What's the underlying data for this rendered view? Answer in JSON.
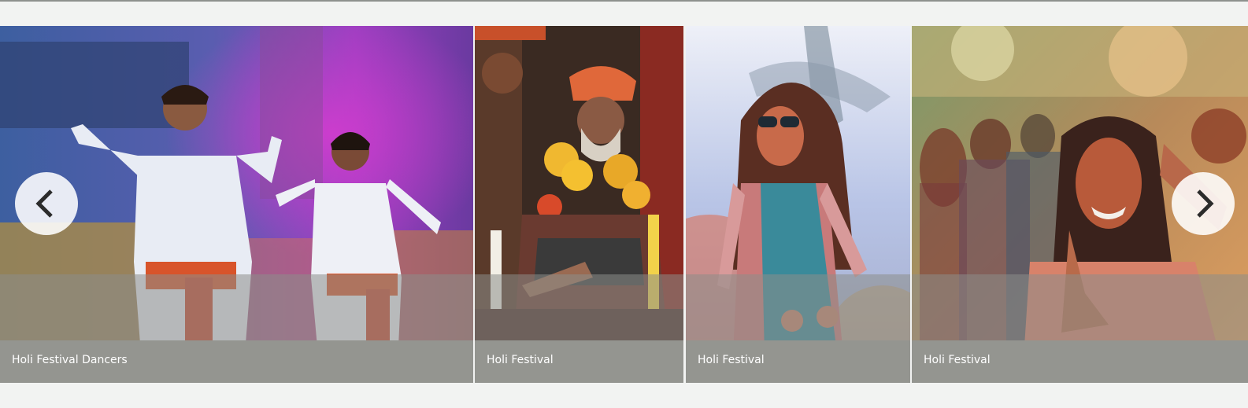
{
  "carousel": {
    "slides": [
      {
        "caption": "Holi Festival Dancers",
        "image": "holi-dancers-photo"
      },
      {
        "caption": "Holi Festival",
        "image": "holi-sadhu-garlands-photo"
      },
      {
        "caption": "Holi Festival",
        "image": "holi-woman-sunglasses-photo"
      },
      {
        "caption": "Holi Festival",
        "image": "holi-smiling-woman-photo"
      }
    ],
    "prev_icon": "chevron-left-icon",
    "next_icon": "chevron-right-icon"
  },
  "colors": {
    "page_background": "#f2f3f2",
    "caption_bar": "#949590",
    "caption_text": "#ffffff",
    "nav_button": "#ffffff",
    "nav_chevron": "#2b2b2b"
  }
}
